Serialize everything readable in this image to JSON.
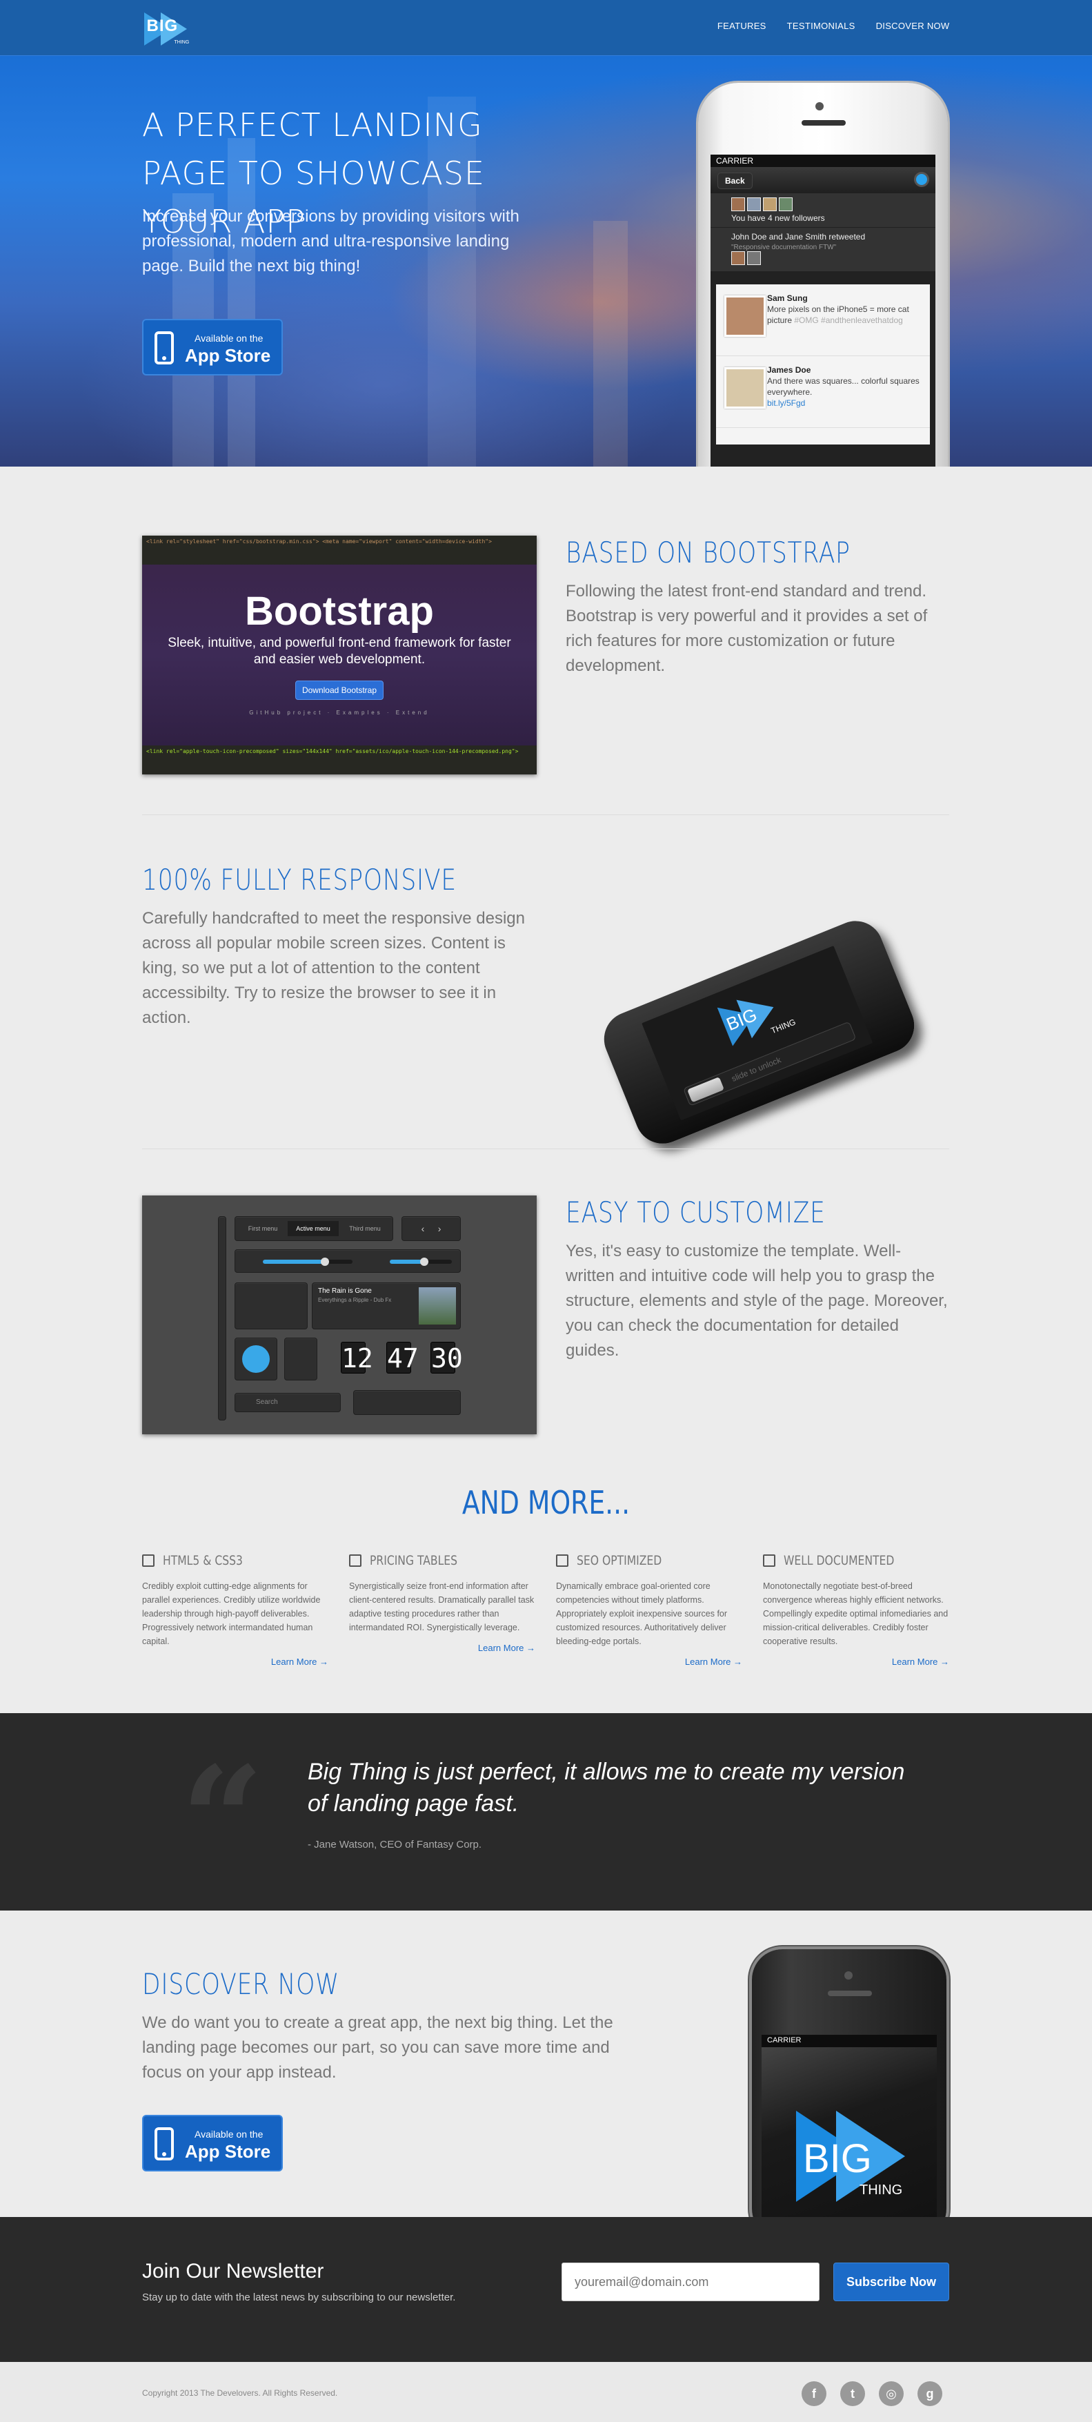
{
  "nav": {
    "logo_big": "BIG",
    "logo_thing": "THING",
    "links": [
      "FEATURES",
      "TESTIMONIALS",
      "DISCOVER NOW"
    ]
  },
  "hero": {
    "title": "A PERFECT LANDING PAGE TO SHOWCASE YOUR APP",
    "subtitle": "Increase your conversions by providing visitors with professional, modern and ultra-responsive landing page. Build the next big thing!",
    "store_small": "Available on the",
    "store_big": "App Store",
    "phone": {
      "carrier": "CARRIER",
      "back": "Back",
      "followers": "You have 4 new followers",
      "retweet": "John Doe and Jane Smith retweeted",
      "retweet_sub": "\"Responsive documentation FTW\"",
      "tweet1_name": "Sam Sung",
      "tweet1_text": "More pixels on the iPhone5 = more cat picture",
      "tweet1_tag": "#OMG #andthenleavethatdog",
      "tweet2_name": "James Doe",
      "tweet2_text": "And there was squares... colorful squares everywhere.",
      "tweet2_link": "bit.ly/5Fgd"
    }
  },
  "bootstrap": {
    "heading": "BASED ON BOOTSTRAP",
    "text": "Following the latest front-end standard and trend. Bootstrap is very powerful and it provides a set of rich features for more customization or future development.",
    "shot_title": "Bootstrap",
    "shot_desc": "Sleek, intuitive, and powerful front-end framework for faster and easier web development.",
    "shot_button": "Download Bootstrap",
    "shot_links": "GitHub project · Examples · Extend"
  },
  "responsive": {
    "heading": "100% FULLY RESPONSIVE",
    "text": "Carefully handcrafted to meet the responsive design across all popular mobile screen sizes. Content is king, so we put a lot of attention to the content accessibilty. Try to resize the browser to see it in action.",
    "phone_logo": "BIG",
    "phone_logo2": "THING",
    "slide": "slide to unlock"
  },
  "customize": {
    "heading": "EASY TO CUSTOMIZE",
    "text": "Yes, it's easy to customize the template. Well-written and intuitive code will help you to grasp the structure, elements and style of the page. Moreover, you can check the documentation for detailed guides.",
    "tabs": [
      "First menu",
      "Active menu",
      "Third menu"
    ],
    "track_title": "The Rain is Gone",
    "track_sub": "Everythings a Ripple - Dub Fx",
    "clock": [
      "12",
      "47",
      "30"
    ],
    "search": "Search"
  },
  "more": {
    "heading": "AND MORE...",
    "features": [
      {
        "title": "HTML5 & CSS3",
        "icon": "html5-icon",
        "text": "Credibly exploit cutting-edge alignments for parallel experiences. Credibly utilize worldwide leadership through high-payoff deliverables. Progressively network intermandated human capital.",
        "more": "Learn More →"
      },
      {
        "title": "PRICING TABLES",
        "icon": "money-icon",
        "text": "Synergistically seize front-end information after client-centered results. Dramatically parallel task adaptive testing procedures rather than intermandated ROI. Synergistically leverage.",
        "more": "Learn More →"
      },
      {
        "title": "SEO OPTIMIZED",
        "icon": "bar-chart-icon",
        "text": "Dynamically embrace goal-oriented core competencies without timely platforms. Appropriately exploit inexpensive sources for customized resources. Authoritatively deliver bleeding-edge portals.",
        "more": "Learn More →"
      },
      {
        "title": "WELL DOCUMENTED",
        "icon": "document-icon",
        "text": "Monotonectally negotiate best-of-breed convergence whereas highly efficient networks. Compellingly expedite optimal infomediaries and mission-critical deliverables. Credibly foster cooperative results.",
        "more": "Learn More →"
      }
    ]
  },
  "testimonial": {
    "quote": "Big Thing is just perfect, it allows me to create my version of landing page fast.",
    "author": "- Jane Watson, CEO of Fantasy Corp."
  },
  "discover": {
    "heading": "DISCOVER NOW",
    "text": "We do want you to create a great app, the next big thing. Let the landing page becomes our part, so you can save more time and focus on your app instead.",
    "store_small": "Available on the",
    "store_big": "App Store",
    "phone_carrier": "CARRIER",
    "phone_big": "BIG",
    "phone_thing": "THING"
  },
  "newsletter": {
    "title": "Join Our Newsletter",
    "subtitle": "Stay up to date with the latest news by subscribing to our newsletter.",
    "placeholder": "youremail@domain.com",
    "button": "Subscribe Now"
  },
  "footer": {
    "copyright": "Copyright 2013 The Develovers. All Rights Reserved.",
    "social": [
      {
        "icon": "facebook-icon",
        "glyph": "f"
      },
      {
        "icon": "twitter-icon",
        "glyph": "t"
      },
      {
        "icon": "dribbble-icon",
        "glyph": "◎"
      },
      {
        "icon": "google-plus-icon",
        "glyph": "g"
      }
    ]
  },
  "colors": {
    "accent": "#1c6bc8",
    "nav": "#1b5fa8",
    "dark": "#2a2a2a",
    "bg": "#ececec"
  }
}
